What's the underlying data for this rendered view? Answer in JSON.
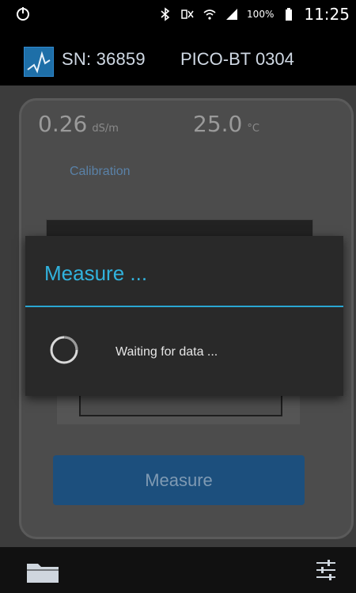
{
  "status_bar": {
    "battery_percent": "100%",
    "time": "11:25",
    "icons": [
      "power-icon",
      "bluetooth-icon",
      "mute-icon",
      "wifi-icon",
      "signal-icon",
      "battery-icon"
    ]
  },
  "app_bar": {
    "serial_label": "SN: 36859",
    "device_model": "PICO-BT 0304",
    "logo_icon": "chart-logo-icon"
  },
  "readings": {
    "conductivity_value": "0.26",
    "conductivity_unit": "dS/m",
    "temperature_value": "25.0",
    "temperature_unit": "°C"
  },
  "calibration_label": "Calibration",
  "measure_button_label": "Measure",
  "dialog": {
    "title": "Measure ...",
    "message": "Waiting for data ...",
    "spinner_icon": "loading-spinner-icon"
  },
  "bottom_bar": {
    "left_icon": "folder-icon",
    "right_icon": "settings-sliders-icon"
  },
  "colors": {
    "accent": "#31b2dd",
    "button": "#1c4f7d",
    "background": "#3c3c3c"
  }
}
